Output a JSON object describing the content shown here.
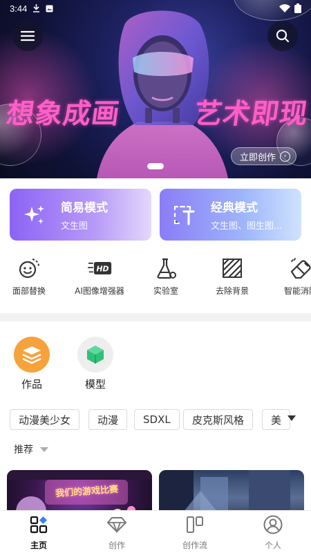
{
  "status_bar": {
    "time": "3:44",
    "icons": [
      "download-icon",
      "image-notification-icon",
      "wifi-icon",
      "battery-icon"
    ]
  },
  "hero": {
    "headline_left": "想象成画",
    "headline_right": "艺术即现",
    "cta_label": "立即创作",
    "menu_icon": "menu-icon",
    "search_icon": "search-icon"
  },
  "modes": [
    {
      "title": "简易模式",
      "subtitle": "文生图",
      "icon": "sparkle-icon"
    },
    {
      "title": "经典模式",
      "subtitle": "文生图、图生图...",
      "icon": "text-tool-icon"
    }
  ],
  "tools": [
    {
      "label": "面部替换",
      "icon": "face-swap-icon"
    },
    {
      "label": "AI图像增强器",
      "icon": "hd-icon"
    },
    {
      "label": "实验室",
      "icon": "flask-icon"
    },
    {
      "label": "去除背景",
      "icon": "remove-background-icon"
    },
    {
      "label": "智能消除",
      "icon": "eraser-icon"
    }
  ],
  "categories": [
    {
      "label": "作品",
      "icon": "layers-icon",
      "color": "#f7a23b"
    },
    {
      "label": "模型",
      "icon": "cube-icon",
      "color": "#2fbf7a"
    }
  ],
  "tags": [
    "动漫美少女",
    "动漫",
    "SDXL",
    "皮克斯风格",
    "美"
  ],
  "sort": {
    "label": "推荐"
  },
  "feed": {
    "card1_title": "我们的游戏比赛"
  },
  "bottom_nav": [
    {
      "label": "主页",
      "icon": "home-grid-icon",
      "active": true
    },
    {
      "label": "创作",
      "icon": "diamond-icon",
      "active": false
    },
    {
      "label": "创作流",
      "icon": "workflow-icon",
      "active": false
    },
    {
      "label": "个人",
      "icon": "user-icon",
      "active": false
    }
  ],
  "colors": {
    "accent_pink": "#ff5fc6",
    "mode_simple": "#8c63f5",
    "mode_classic": "#8a7cf6",
    "works_orange": "#f7a23b",
    "model_green": "#2fbf7a"
  }
}
